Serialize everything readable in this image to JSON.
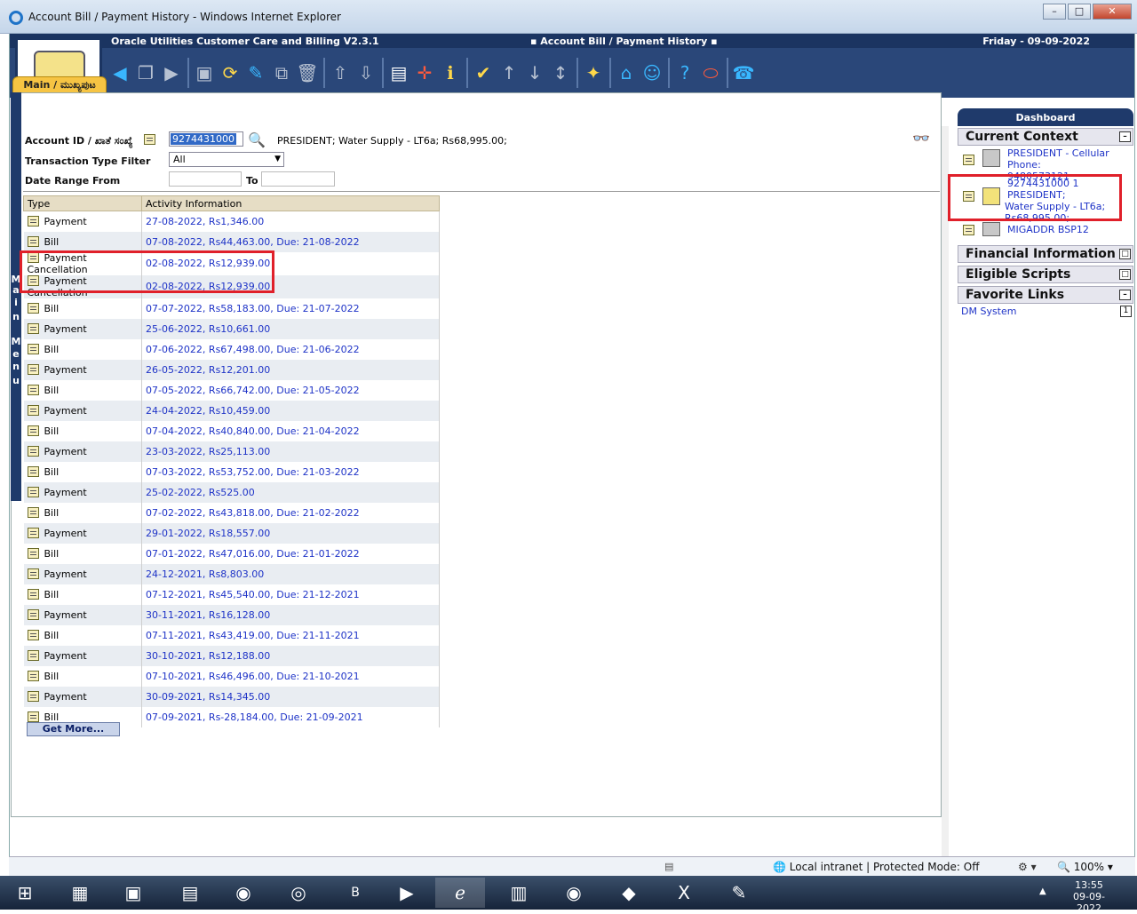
{
  "window": {
    "title": "Account Bill / Payment History - Windows Internet Explorer"
  },
  "header": {
    "app": "Oracle Utilities Customer Care and Billing V2.3.1",
    "page": "Account Bill / Payment History",
    "date": "Friday - 09-09-2022"
  },
  "tab": {
    "main": "Main / ಮುಖ್ಯಪುಟ"
  },
  "sidestrip": [
    "M",
    "a",
    "i",
    "n",
    "M",
    "e",
    "n",
    "u"
  ],
  "form": {
    "account_label": "Account ID / ಖಾತೆ ಸಂಖ್ಯೆ",
    "account_value": "9274431000",
    "account_desc": "PRESIDENT; Water Supply - LT6a; Rs68,995.00;",
    "filter_label": "Transaction Type Filter",
    "filter_value": "All",
    "date_from_label": "Date Range From",
    "date_to_label": "To"
  },
  "table": {
    "headers": [
      "Type",
      "Activity Information"
    ],
    "rows": [
      [
        "Payment",
        "27-08-2022, Rs1,346.00"
      ],
      [
        "Bill",
        "07-08-2022, Rs44,463.00, Due: 21-08-2022"
      ],
      [
        "Payment Cancellation",
        "02-08-2022, Rs12,939.00"
      ],
      [
        "Payment Cancellation",
        "02-08-2022, Rs12,939.00"
      ],
      [
        "Bill",
        "07-07-2022, Rs58,183.00, Due: 21-07-2022"
      ],
      [
        "Payment",
        "25-06-2022, Rs10,661.00"
      ],
      [
        "Bill",
        "07-06-2022, Rs67,498.00, Due: 21-06-2022"
      ],
      [
        "Payment",
        "26-05-2022, Rs12,201.00"
      ],
      [
        "Bill",
        "07-05-2022, Rs66,742.00, Due: 21-05-2022"
      ],
      [
        "Payment",
        "24-04-2022, Rs10,459.00"
      ],
      [
        "Bill",
        "07-04-2022, Rs40,840.00, Due: 21-04-2022"
      ],
      [
        "Payment",
        "23-03-2022, Rs25,113.00"
      ],
      [
        "Bill",
        "07-03-2022, Rs53,752.00, Due: 21-03-2022"
      ],
      [
        "Payment",
        "25-02-2022, Rs525.00"
      ],
      [
        "Bill",
        "07-02-2022, Rs43,818.00, Due: 21-02-2022"
      ],
      [
        "Payment",
        "29-01-2022, Rs18,557.00"
      ],
      [
        "Bill",
        "07-01-2022, Rs47,016.00, Due: 21-01-2022"
      ],
      [
        "Payment",
        "24-12-2021, Rs8,803.00"
      ],
      [
        "Bill",
        "07-12-2021, Rs45,540.00, Due: 21-12-2021"
      ],
      [
        "Payment",
        "30-11-2021, Rs16,128.00"
      ],
      [
        "Bill",
        "07-11-2021, Rs43,419.00, Due: 21-11-2021"
      ],
      [
        "Payment",
        "30-10-2021, Rs12,188.00"
      ],
      [
        "Bill",
        "07-10-2021, Rs46,496.00, Due: 21-10-2021"
      ],
      [
        "Payment",
        "30-09-2021, Rs14,345.00"
      ],
      [
        "Bill",
        "07-09-2021, Rs-28,184.00, Due: 21-09-2021"
      ]
    ],
    "get_more": "Get More..."
  },
  "dashboard": {
    "title": "Dashboard",
    "current_context": "Current Context",
    "ctx1_line1": "PRESIDENT - Cellular Phone:",
    "ctx1_line2": "9480573121",
    "ctx2_line1": "9274431000 1 PRESIDENT;",
    "ctx2_line2": "Water Supply - LT6a;",
    "ctx2_line3": "Rs68,995.00;",
    "ctx3": "MIGADDR BSP12",
    "financial": "Financial Information",
    "scripts": "Eligible Scripts",
    "favorites": "Favorite Links",
    "fav1": "DM System",
    "fav1_key": "1"
  },
  "status": {
    "zone": "Local intranet | Protected Mode: Off",
    "zoom": "100%"
  },
  "taskbar": {
    "time": "13:55",
    "date": "09-09-2022",
    "b_label": "B"
  }
}
